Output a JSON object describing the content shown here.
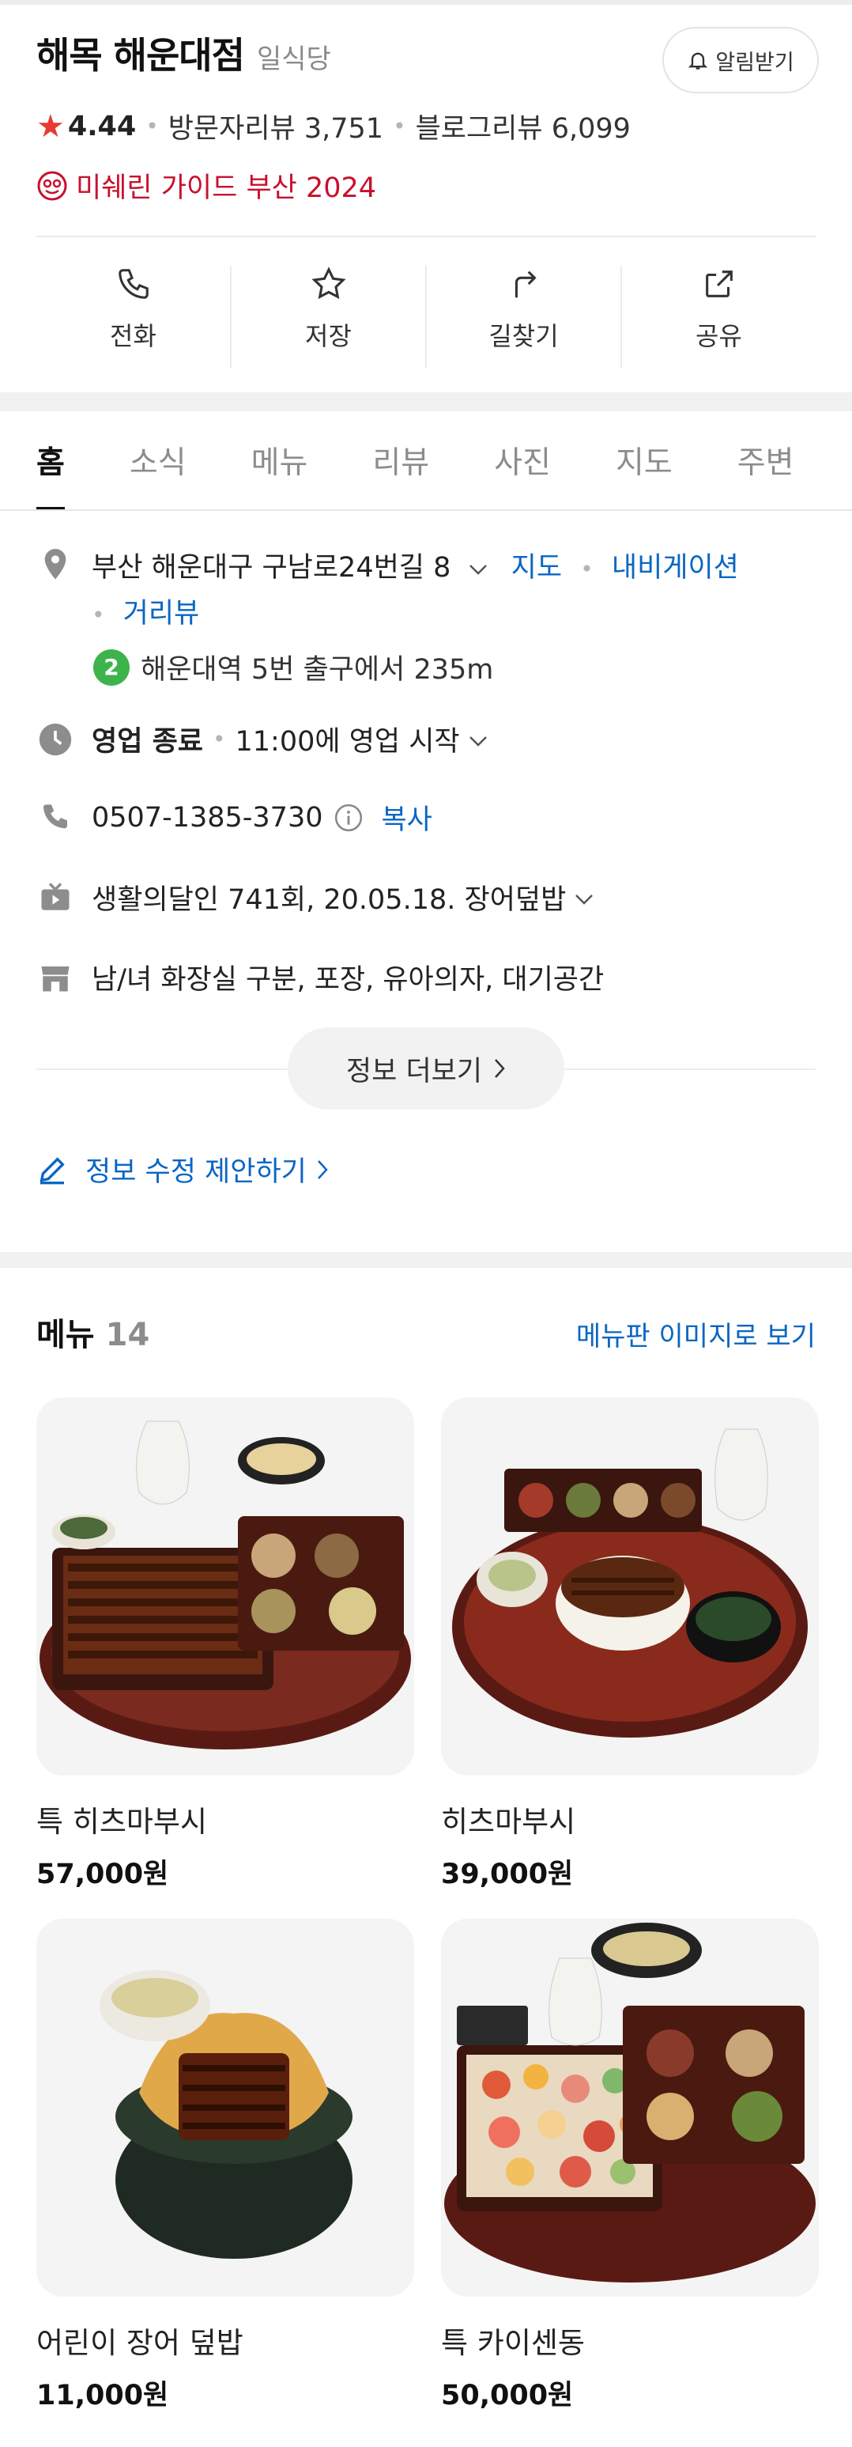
{
  "place": {
    "name": "해목 해운대점",
    "category": "일식당",
    "alarm_label": "알림받기",
    "rating": "4.44",
    "visitor_reviews": "방문자리뷰 3,751",
    "blog_reviews": "블로그리뷰 6,099",
    "michelin": "미쉐린 가이드 부산 2024"
  },
  "actions": [
    {
      "label": "전화",
      "icon": "phone-icon"
    },
    {
      "label": "저장",
      "icon": "star-icon"
    },
    {
      "label": "길찾기",
      "icon": "directions-icon"
    },
    {
      "label": "공유",
      "icon": "share-icon"
    }
  ],
  "tabs": [
    "홈",
    "소식",
    "메뉴",
    "리뷰",
    "사진",
    "지도",
    "주변"
  ],
  "info": {
    "address": "부산 해운대구 구남로24번길 8",
    "map_link": "지도",
    "navi_link": "내비게이션",
    "roadview_link": "거리뷰",
    "subway_line": "2",
    "subway_text": "해운대역 5번 출구에서 235m",
    "hours_status": "영업 종료",
    "hours_next": "11:00에 영업 시작",
    "phone": "0507-1385-3730",
    "copy_label": "복사",
    "tv": "생활의달인 741회, 20.05.18. 장어덮밥",
    "amenities": "남/녀 화장실 구분, 포장, 유아의자, 대기공간",
    "more_label": "정보 더보기",
    "suggest_label": "정보 수정 제안하기"
  },
  "menu": {
    "title": "메뉴",
    "count": "14",
    "view_label": "메뉴판 이미지로 보기",
    "items": [
      {
        "name": "특 히츠마부시",
        "price": "57,000원"
      },
      {
        "name": "히츠마부시",
        "price": "39,000원"
      },
      {
        "name": "어린이 장어 덮밥",
        "price": "11,000원"
      },
      {
        "name": "특 카이센동",
        "price": "50,000원"
      }
    ]
  },
  "colors": {
    "accent_link": "#0a66c2",
    "rating_star": "#e83a30",
    "michelin": "#c8102e",
    "subway_line2": "#3cb44b"
  }
}
